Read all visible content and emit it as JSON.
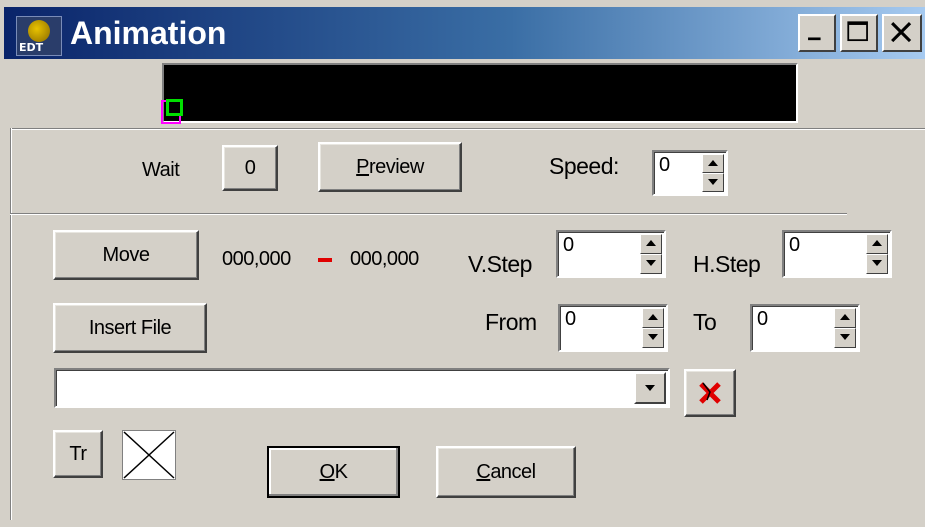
{
  "window": {
    "title": "Animation",
    "icon_text": "EDT",
    "icon": "app-globe-icon",
    "controls": [
      "minimize-icon",
      "maximize-icon",
      "close-icon"
    ]
  },
  "wait": {
    "label": "Wait",
    "value": "0"
  },
  "preview_button": {
    "label": "Preview",
    "mnemonic": "P"
  },
  "speed": {
    "label": "Speed:",
    "value": "0"
  },
  "move_button": {
    "label": "Move"
  },
  "coords": {
    "from": "000,000",
    "to": "000,000",
    "separator_color": "#e00000"
  },
  "vstep": {
    "label": "V.Step",
    "value": "0"
  },
  "hstep": {
    "label": "H.Step",
    "value": "0"
  },
  "insert_file_button": {
    "label": "Insert File"
  },
  "from": {
    "label": "From",
    "value": "0"
  },
  "to": {
    "label": "To",
    "value": "0"
  },
  "file_combo": {
    "value": ""
  },
  "delete_icon": "red-x-icon",
  "tr_button": {
    "label": "Tr"
  },
  "transparent_color_icon": "empty-color-swatch-icon",
  "ok_button": {
    "label": "OK",
    "mnemonic": "O"
  },
  "cancel_button": {
    "label": "Cancel",
    "mnemonic": "C"
  },
  "colors": {
    "titlebar_start": "#0a246a",
    "titlebar_end": "#a6caf0",
    "face": "#d4d0c8",
    "marker_pink": "#ff00ff",
    "marker_green": "#00e000"
  }
}
